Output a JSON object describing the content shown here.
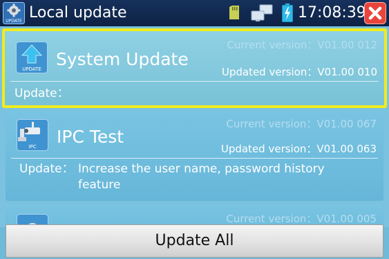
{
  "window": {
    "title": "Local update",
    "app_icon_label": "UPDATE",
    "time": "17:08:39"
  },
  "status_icons": [
    "sd-card-icon",
    "network-icon",
    "battery-charging-icon",
    "close-icon"
  ],
  "items": [
    {
      "name": "System Update",
      "icon_label": "UPDATE",
      "current_version": "Current version：V01.00 012",
      "updated_version": "Updated version：V01.00 010",
      "update_label": "Update：",
      "update_text": "",
      "selected": true
    },
    {
      "name": "IPC Test",
      "icon_label": "IPC",
      "current_version": "Current version：V01.00 067",
      "updated_version": "Updated version：V01.00 063",
      "update_label": "Update：",
      "update_text": "Increase the user name, password history feature",
      "selected": false
    },
    {
      "name": "",
      "icon_label": "",
      "current_version": "Current version：V01.00 005",
      "updated_version": "",
      "update_label": "",
      "update_text": "",
      "selected": false
    }
  ],
  "footer": {
    "update_all_label": "Update All"
  },
  "colors": {
    "titlebar": "#16315d",
    "list_background": "#7ac2df",
    "selection_border": "#f2ec1c",
    "close_button": "#e8453c",
    "battery": "#2fb9e8"
  }
}
